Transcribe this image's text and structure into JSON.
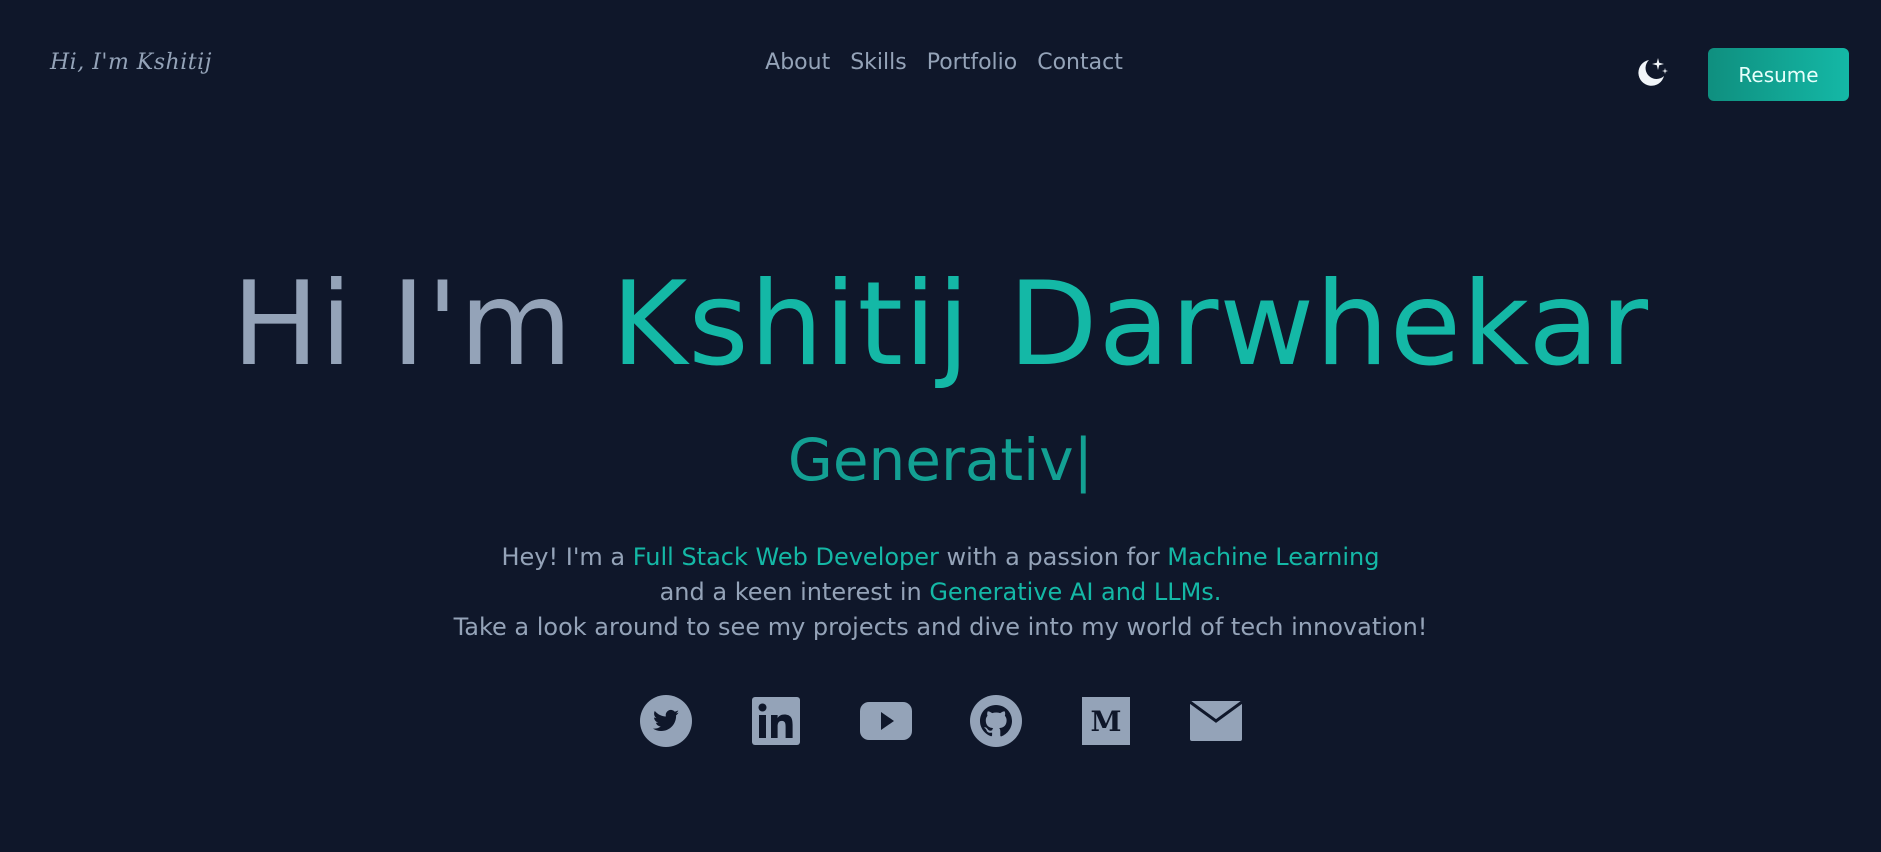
{
  "header": {
    "logo": "Hi, I'm Kshitij",
    "nav": [
      "About",
      "Skills",
      "Portfolio",
      "Contact"
    ],
    "theme_toggle_icon": "moon-stars-icon",
    "resume_label": "Resume"
  },
  "hero": {
    "greeting": "Hi I'm ",
    "name": "Kshitij Darwhekar",
    "typed_text": "Generativ",
    "typed_cursor": "|",
    "intro": {
      "l1_a": "Hey! I'm a ",
      "l1_b": "Full Stack Web Developer",
      "l1_c": " with a passion for ",
      "l1_d": "Machine Learning",
      "l2_a": "and a keen interest in ",
      "l2_b": "Generative AI and LLMs.",
      "l3": "Take a look around to see my projects and dive into my world of tech innovation!"
    }
  },
  "socials": [
    {
      "icon": "twitter-icon"
    },
    {
      "icon": "linkedin-icon"
    },
    {
      "icon": "youtube-icon"
    },
    {
      "icon": "github-icon"
    },
    {
      "icon": "medium-icon"
    },
    {
      "icon": "email-icon"
    }
  ],
  "colors": {
    "background": "#0f172a",
    "text": "#94a3b8",
    "accent": "#14b8a6"
  }
}
